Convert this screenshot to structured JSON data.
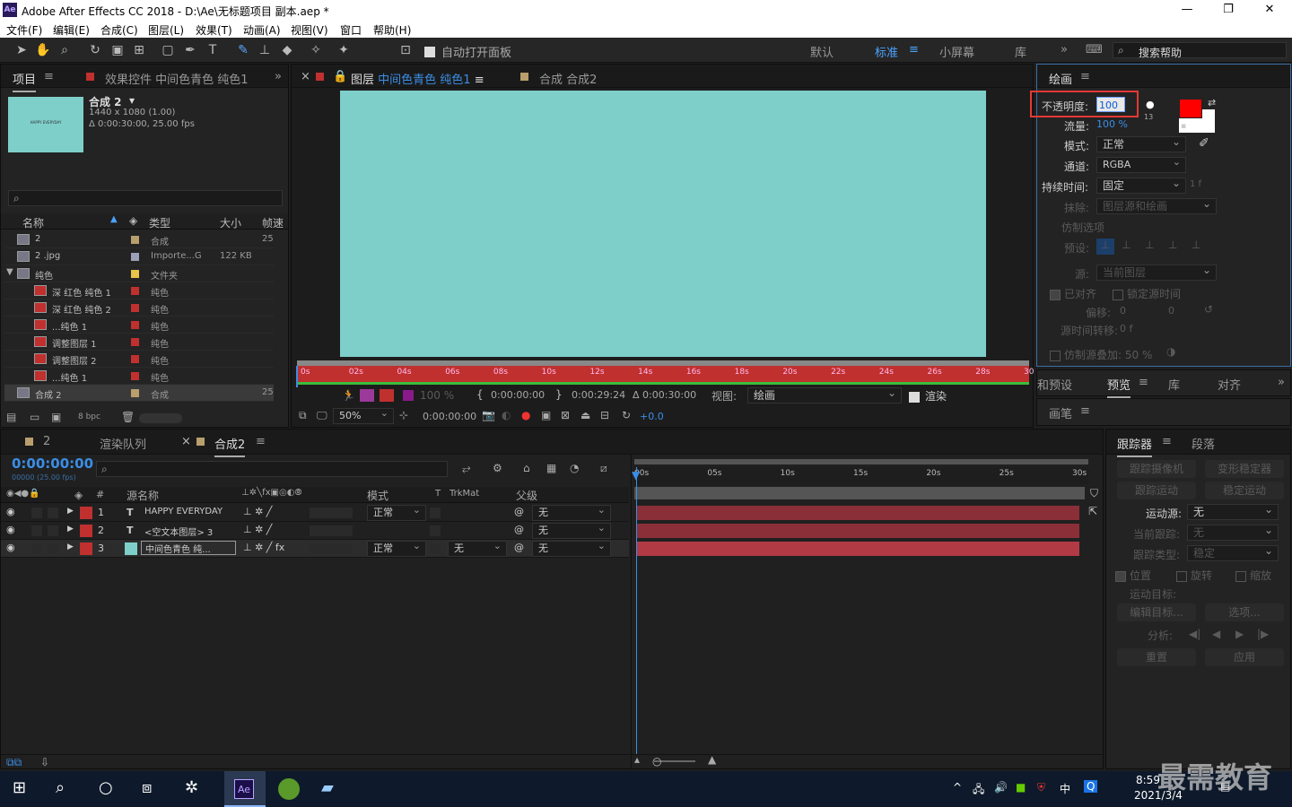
{
  "title": "Adobe After Effects CC 2018 - D:\\Ae\\无标题项目 副本.aep *",
  "app_logo": "Ae",
  "menu": [
    "文件(F)",
    "编辑(E)",
    "合成(C)",
    "图层(L)",
    "效果(T)",
    "动画(A)",
    "视图(V)",
    "窗口",
    "帮助(H)"
  ],
  "toolbar": {
    "auto_open": "自动打开面板",
    "workspaces": [
      "默认",
      "标准",
      "小屏幕",
      "库"
    ],
    "search": "搜索帮助"
  },
  "project": {
    "tabs": [
      "项目",
      "效果控件 中间色青色 纯色1"
    ],
    "comp_name": "合成 2",
    "comp_res": "1440 x 1080 (1.00)",
    "comp_dur": "Δ 0:00:30:00, 25.00 fps",
    "thumb_text": "HAPPY EVERYDAY",
    "columns": [
      "名称",
      "类型",
      "大小",
      "帧速"
    ],
    "items": [
      {
        "name": "2",
        "type": "合成",
        "size": "",
        "fps": "25",
        "color": "#b89f6c"
      },
      {
        "name": "2 .jpg",
        "type": "Importe...G",
        "size": "122 KB",
        "fps": "",
        "color": "#9aa0b8"
      },
      {
        "name": "纯色",
        "type": "文件夹",
        "size": "",
        "fps": "",
        "color": "#e8c24a"
      },
      {
        "name": "深 红色 纯色 1",
        "type": "纯色",
        "size": "",
        "fps": "",
        "color": "#c0302f"
      },
      {
        "name": "深 红色 纯色 2",
        "type": "纯色",
        "size": "",
        "fps": "",
        "color": "#c0302f"
      },
      {
        "name": "...纯色 1",
        "type": "纯色",
        "size": "",
        "fps": "",
        "color": "#c0302f"
      },
      {
        "name": "调整图层 1",
        "type": "纯色",
        "size": "",
        "fps": "",
        "color": "#c0302f"
      },
      {
        "name": "调整图层 2",
        "type": "纯色",
        "size": "",
        "fps": "",
        "color": "#c0302f"
      },
      {
        "name": "...纯色 1",
        "type": "纯色",
        "size": "",
        "fps": "",
        "color": "#c0302f"
      },
      {
        "name": "合成 2",
        "type": "合成",
        "size": "",
        "fps": "25",
        "color": "#b89f6c"
      }
    ],
    "bpc": "8 bpc"
  },
  "viewer": {
    "tabs": [
      "图层 中间色青色 纯色1",
      "合成 合成2"
    ],
    "layer_prefix": "图层",
    "layer_name": "中间色青色 纯色1",
    "ruler": [
      "0s",
      "02s",
      "04s",
      "06s",
      "08s",
      "10s",
      "12s",
      "14s",
      "16s",
      "18s",
      "20s",
      "22s",
      "24s",
      "26s",
      "28s",
      "30"
    ],
    "start": "0:00:00:00",
    "end": "0:00:29:24",
    "dur": "Δ 0:00:30:00",
    "view_label": "视图:",
    "view_value": "绘画",
    "render": "渲染",
    "zoom": "50%",
    "time": "0:00:00:00",
    "exposure": "+0.0",
    "opacity_dim": "100 %",
    "cyan": "#7ecfca"
  },
  "paint": {
    "title": "绘画",
    "opacity_label": "不透明度:",
    "opacity_value": "100",
    "flow_label": "流量:",
    "flow_value": "100 %",
    "mode_label": "模式:",
    "mode_value": "正常",
    "channel_label": "通道:",
    "channel_value": "RGBA",
    "duration_label": "持续时间:",
    "duration_value": "固定",
    "duration_suffix": "1 f",
    "erase_label": "抹除:",
    "erase_value": "图层源和绘画",
    "clone_title": "仿制选项",
    "preset_label": "预设:",
    "source_label": "源:",
    "source_value": "当前图层",
    "aligned": "已对齐",
    "lock_time": "锁定源时间",
    "offset_label": "偏移:",
    "offset_x": "0",
    "offset_y": "0",
    "src_time_label": "源时间转移:",
    "src_time_value": "0 f",
    "overlay": "仿制源叠加: 50 %",
    "brush_size": "13",
    "fg_color": "#ff0000",
    "bg_color": "#ffffff"
  },
  "preview_tabs": [
    "和预设",
    "预览",
    "库",
    "对齐"
  ],
  "brush_title": "画笔",
  "tracker": {
    "tabs": [
      "跟踪器",
      "段落"
    ],
    "btn_track_cam": "跟踪摄像机",
    "btn_warp": "变形稳定器",
    "btn_track_motion": "跟踪运动",
    "btn_stabilize": "稳定运动",
    "source_label": "运动源:",
    "source_value": "无",
    "current_label": "当前跟踪:",
    "current_value": "无",
    "type_label": "跟踪类型:",
    "type_value": "稳定",
    "pos": "位置",
    "rot": "旋转",
    "scale": "缩放",
    "target_label": "运动目标:",
    "edit_target": "编辑目标...",
    "options": "选项...",
    "analyze_label": "分析:",
    "reset": "重置",
    "apply": "应用"
  },
  "timeline": {
    "tabs": [
      "2",
      "渲染队列",
      "合成2"
    ],
    "timecode": "0:00:00:00",
    "frames": "00000 (25.00 fps)",
    "cols": {
      "num": "#",
      "name": "源名称",
      "mode": "模式",
      "t": "T",
      "trk": "TrkMat",
      "parent": "父级"
    },
    "ruler": [
      "00s",
      "05s",
      "10s",
      "15s",
      "20s",
      "25s",
      "30s"
    ],
    "layers": [
      {
        "num": "1",
        "type": "T",
        "name": "HAPPY EVERYDAY",
        "mode": "正常",
        "trk": "",
        "parent": "无",
        "color": "#c0302f"
      },
      {
        "num": "2",
        "type": "T",
        "name": "<空文本图层> 3",
        "mode": "",
        "trk": "",
        "parent": "无",
        "color": "#c0302f"
      },
      {
        "num": "3",
        "type": "",
        "name": "中间色青色 纯...",
        "mode": "正常",
        "trk": "无",
        "parent": "无",
        "color": "#c0302f"
      }
    ]
  },
  "taskbar": {
    "time": "8:59",
    "date": "2021/3/4",
    "ime": "中",
    "watermark": "最需教育"
  }
}
